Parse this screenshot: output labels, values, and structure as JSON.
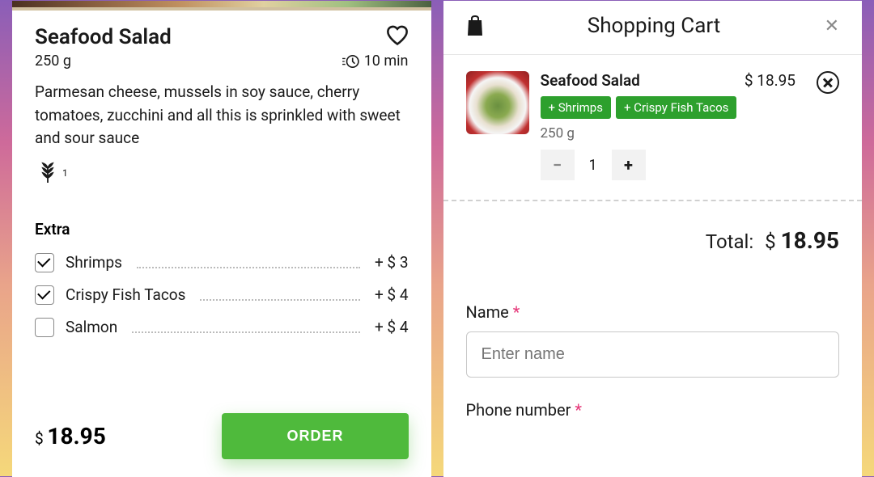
{
  "product": {
    "title": "Seafood Salad",
    "weight": "250 g",
    "prep_time": "10 min",
    "description": "Parmesan cheese, mussels in soy sauce, cherry tomatoes, zucchini and all this is sprinkled with sweet and sour sauce",
    "allergen_count": "1",
    "extras_title": "Extra",
    "extras": [
      {
        "label": "Shrimps",
        "price": "+ $ 3",
        "checked": true
      },
      {
        "label": "Crispy Fish Tacos",
        "price": "+ $ 4",
        "checked": true
      },
      {
        "label": "Salmon",
        "price": "+ $ 4",
        "checked": false
      }
    ],
    "currency": "$",
    "total_amount": "18.95",
    "order_label": "ORDER"
  },
  "cart": {
    "title": "Shopping Cart",
    "item": {
      "name": "Seafood Salad",
      "price": "$ 18.95",
      "tags": [
        "+ Shrimps",
        "+ Crispy Fish Tacos"
      ],
      "weight": "250 g",
      "quantity": "1"
    },
    "total_label": "Total:",
    "total_currency": "$",
    "total_amount": "18.95",
    "form": {
      "name_label": "Name",
      "name_placeholder": "Enter name",
      "phone_label": "Phone number",
      "required_mark": "*"
    }
  }
}
